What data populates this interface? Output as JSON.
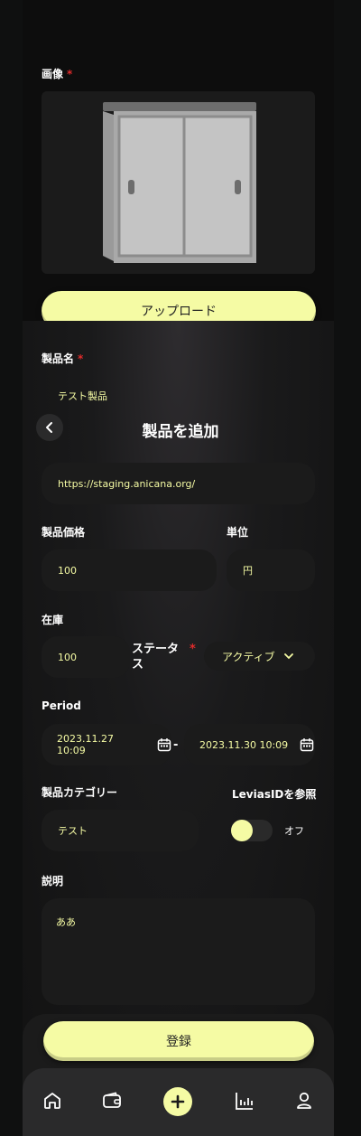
{
  "image_section": {
    "label": "画像",
    "required_mark": "*"
  },
  "upload_button": "アップロード",
  "header": {
    "title": "製品を追加"
  },
  "product_name": {
    "label": "製品名",
    "required_mark": "*",
    "value": "テスト製品"
  },
  "url_field": {
    "value": "https://staging.anicana.org/"
  },
  "price": {
    "label": "製品価格",
    "value": "100"
  },
  "unit": {
    "label": "単位",
    "value": "円"
  },
  "stock": {
    "label": "在庫",
    "value": "100"
  },
  "status": {
    "label_line1": "ステータ",
    "label_line2": "ス",
    "required_mark": "*",
    "value": "アクティブ"
  },
  "period": {
    "label": "Period",
    "start": "2023.11.27 10:09",
    "separator": "-",
    "end": "2023.11.30 10:09"
  },
  "category": {
    "label": "製品カテゴリー",
    "value": "テスト"
  },
  "levias": {
    "label": "LeviasIDを参照",
    "toggle_text": "オフ",
    "toggle_on": false
  },
  "description": {
    "label": "説明",
    "value": "ああ"
  },
  "register_button": "登録",
  "nav": {
    "items": [
      "home-icon",
      "wallet-icon",
      "add-icon",
      "chart-icon",
      "user-icon"
    ]
  },
  "colors": {
    "accent": "#f5fba4",
    "background": "#0f1010",
    "field": "#1b1b1b",
    "required": "#e02b2b"
  }
}
